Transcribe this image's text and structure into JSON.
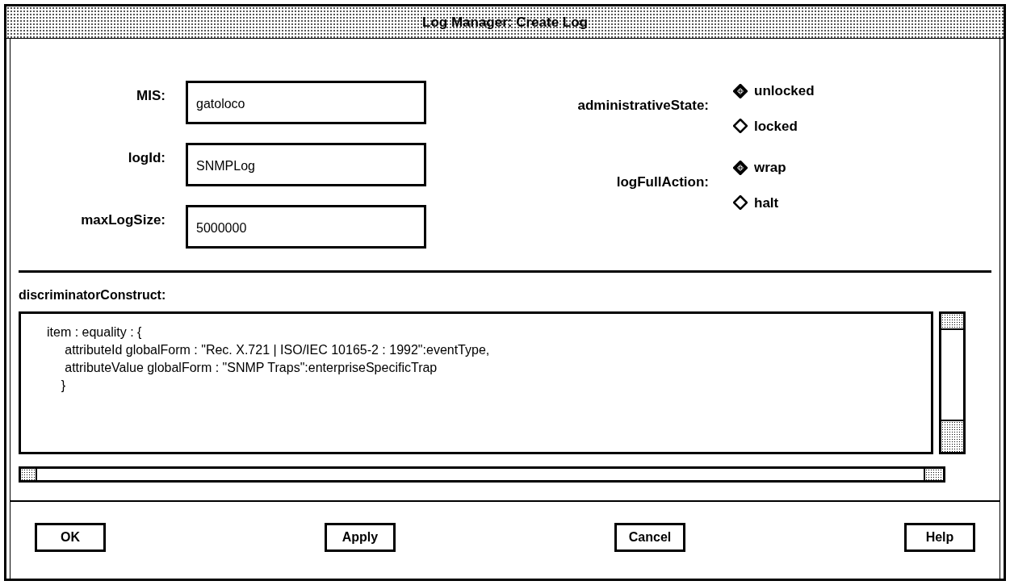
{
  "window": {
    "title": "Log Manager: Create Log"
  },
  "fields": [
    {
      "label": "MIS:",
      "value": "gatoloco"
    },
    {
      "label": "logId:",
      "value": "SNMPLog"
    },
    {
      "label": "maxLogSize:",
      "value": "5000000"
    }
  ],
  "radio_groups": [
    {
      "label": "administrativeState:",
      "options": [
        {
          "label": "unlocked",
          "selected": true
        },
        {
          "label": "locked",
          "selected": false
        }
      ]
    },
    {
      "label": "logFullAction:",
      "options": [
        {
          "label": "wrap",
          "selected": true
        },
        {
          "label": "halt",
          "selected": false
        }
      ]
    }
  ],
  "discriminator": {
    "label": "discriminatorConstruct:",
    "lines": [
      "item : equality : {",
      "     attributeId globalForm : \"Rec. X.721 | ISO/IEC 10165-2 : 1992\":eventType,",
      "     attributeValue globalForm : \"SNMP Traps\":enterpriseSpecificTrap",
      "    }"
    ]
  },
  "buttons": [
    "OK",
    "Apply",
    "Cancel",
    "Help"
  ]
}
